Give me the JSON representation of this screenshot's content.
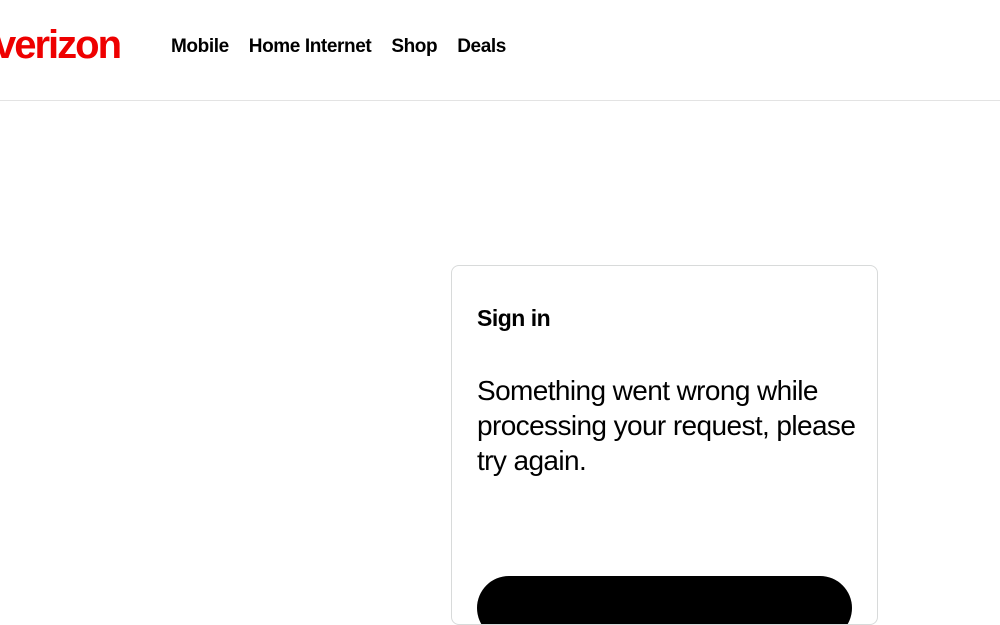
{
  "brand": {
    "logo_text": "verizon",
    "logo_color": "#ee0000"
  },
  "nav": {
    "items": [
      {
        "label": "Mobile"
      },
      {
        "label": "Home Internet"
      },
      {
        "label": "Shop"
      },
      {
        "label": "Deals"
      }
    ]
  },
  "signin_card": {
    "title": "Sign in",
    "message": "Something went wrong while processing your request, please try again.",
    "button_color": "#000000"
  }
}
